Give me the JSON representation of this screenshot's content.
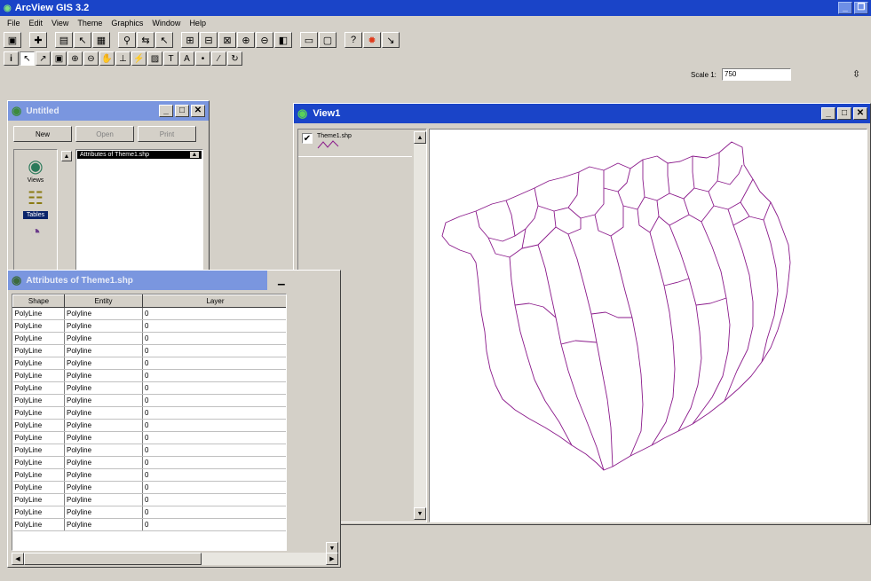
{
  "app": {
    "title": "ArcView GIS 3.2",
    "title_icon": "q-globe-icon",
    "menu": [
      "File",
      "Edit",
      "View",
      "Theme",
      "Graphics",
      "Window",
      "Help"
    ]
  },
  "toolbar2": {
    "scale_label": "Scale 1:",
    "scale_value": "750"
  },
  "project_window": {
    "title": "Untitled",
    "buttons": [
      "New",
      "Open",
      "Print"
    ],
    "doc_types": [
      "Views",
      "Tables"
    ],
    "selected_type": "Tables",
    "list_items": [
      "Attributes of Theme1.shp"
    ]
  },
  "attr_table": {
    "title": "Attributes of Theme1.shp",
    "columns": [
      "Shape",
      "Entity",
      "Layer"
    ],
    "rows": [
      [
        "PolyLine",
        "Polyline",
        "0"
      ],
      [
        "PolyLine",
        "Polyline",
        "0"
      ],
      [
        "PolyLine",
        "Polyline",
        "0"
      ],
      [
        "PolyLine",
        "Polyline",
        "0"
      ],
      [
        "PolyLine",
        "Polyline",
        "0"
      ],
      [
        "PolyLine",
        "Polyline",
        "0"
      ],
      [
        "PolyLine",
        "Polyline",
        "0"
      ],
      [
        "PolyLine",
        "Polyline",
        "0"
      ],
      [
        "PolyLine",
        "Polyline",
        "0"
      ],
      [
        "PolyLine",
        "Polyline",
        "0"
      ],
      [
        "PolyLine",
        "Polyline",
        "0"
      ],
      [
        "PolyLine",
        "Polyline",
        "0"
      ],
      [
        "PolyLine",
        "Polyline",
        "0"
      ],
      [
        "PolyLine",
        "Polyline",
        "0"
      ],
      [
        "PolyLine",
        "Polyline",
        "0"
      ],
      [
        "PolyLine",
        "Polyline",
        "0"
      ],
      [
        "PolyLine",
        "Polyline",
        "0"
      ],
      [
        "PolyLine",
        "Polyline",
        "0"
      ]
    ]
  },
  "view_window": {
    "title": "View1",
    "legend_theme": "Theme1.shp",
    "theme_checked": true,
    "line_color": "#8b1a8b"
  },
  "colors": {
    "active_title": "#0a246a",
    "inactive_title": "#7a96df",
    "face": "#d4d0c8"
  }
}
